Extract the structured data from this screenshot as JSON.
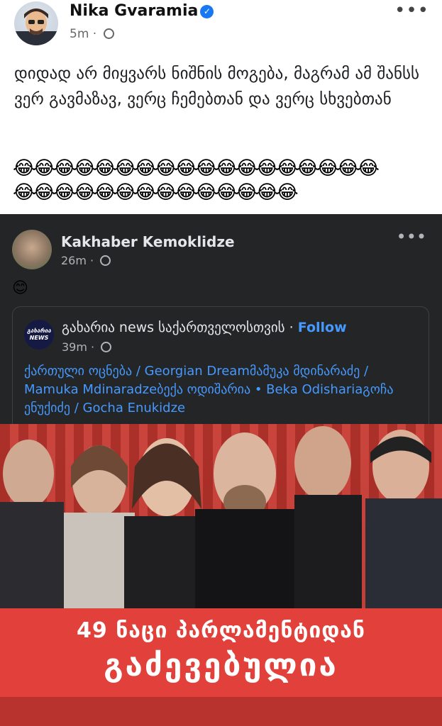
{
  "post": {
    "author": "Nika Gvaramia",
    "time": "5m",
    "text": "დიდად არ მიყვარს ნიშნის მოგება, მაგრამ ამ შანსს ვერ გავმაზავ, ვერც ჩემებთან და ვერც სხვებთან",
    "emoji_row_1": "😂😂😂😂😂😂😂😂😂😂😂😂😂😂😂😂😂😂",
    "emoji_row_2": "😂😂😂😂😂😂😂😂😂😂😂😂😂😂"
  },
  "shared": {
    "author": "Kakhaber Kemoklidze",
    "time": "26m",
    "text": "😊",
    "card": {
      "page_name": "გახარია news საქართველოსთვის",
      "separator": "·",
      "follow_label": "Follow",
      "avatar_text": "გახარია NEWS",
      "time": "39m",
      "tags": "ქართული ოცნება / Georgian Dreamმამუკა მდინარაძე / Mamuka Mdinaradzeბექა ოდიშარია • Beka Odishariaგოჩა ენუქიძე / Gocha Enukidze"
    },
    "image": {
      "line1": "49 ნაცი პარლამენტიდან",
      "line2": "გაძევებულია"
    }
  },
  "icons": {
    "verified": "verified-badge-icon",
    "audience": "globe-icon",
    "more": "more-options-icon"
  },
  "colors": {
    "accent": "#1877f2",
    "link": "#4599ff",
    "dark_surface": "#242526",
    "banner_red": "#e1413a"
  }
}
